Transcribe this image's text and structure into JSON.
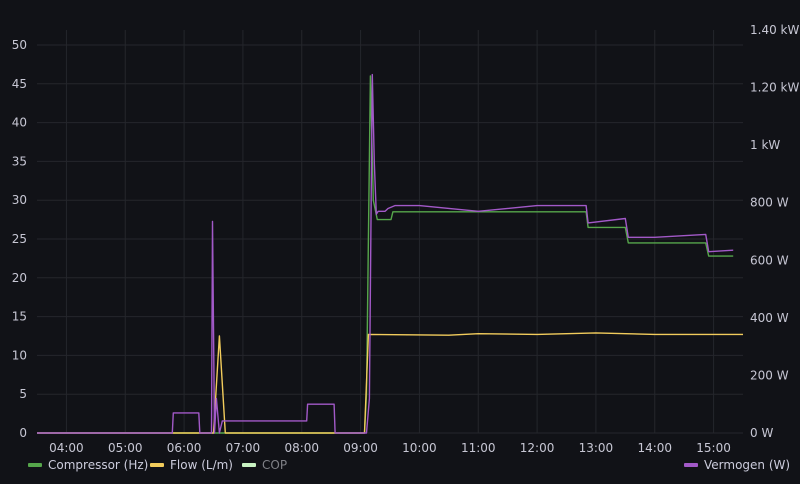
{
  "chart_data": {
    "type": "line",
    "x_label_type": "time",
    "x_ticks": [
      "04:00",
      "05:00",
      "06:00",
      "07:00",
      "08:00",
      "09:00",
      "10:00",
      "11:00",
      "12:00",
      "13:00",
      "14:00",
      "15:00"
    ],
    "x_range": [
      "03:30",
      "15:30"
    ],
    "y_left": {
      "ticks": [
        "0",
        "5",
        "10",
        "15",
        "20",
        "25",
        "30",
        "35",
        "40",
        "45",
        "50"
      ],
      "range": [
        0,
        50
      ]
    },
    "y_right": {
      "ticks": [
        "0 W",
        "200 W",
        "400 W",
        "600 W",
        "800 W",
        "1 kW",
        "1.20 kW",
        "1.40 kW"
      ],
      "range_watts": [
        0,
        1400
      ]
    },
    "grid": true,
    "legend_position": "bottom",
    "series": [
      {
        "name": "Compressor (Hz)",
        "axis": "left",
        "color": "#56a64b",
        "points": [
          [
            "03:30",
            0
          ],
          [
            "09:04",
            0
          ],
          [
            "09:06",
            5
          ],
          [
            "09:10",
            46
          ],
          [
            "09:13",
            30
          ],
          [
            "09:17",
            27.5
          ],
          [
            "09:31",
            27.5
          ],
          [
            "09:33",
            28.5
          ],
          [
            "12:50",
            28.5
          ],
          [
            "12:52",
            26.5
          ],
          [
            "13:30",
            26.5
          ],
          [
            "13:33",
            24.5
          ],
          [
            "14:52",
            24.5
          ],
          [
            "14:55",
            22.8
          ],
          [
            "15:20",
            22.8
          ]
        ]
      },
      {
        "name": "Flow (L/m)",
        "axis": "left",
        "color": "#f2cc5c",
        "points": [
          [
            "03:30",
            0
          ],
          [
            "06:30",
            0
          ],
          [
            "06:36",
            12.5
          ],
          [
            "06:42",
            0
          ],
          [
            "09:04",
            0
          ],
          [
            "09:08",
            12.7
          ],
          [
            "10:30",
            12.6
          ],
          [
            "11:00",
            12.8
          ],
          [
            "12:00",
            12.7
          ],
          [
            "13:00",
            12.9
          ],
          [
            "14:00",
            12.7
          ],
          [
            "15:30",
            12.7
          ]
        ]
      },
      {
        "name": "COP",
        "axis": "left",
        "color": "#c8f2c2",
        "muted": true,
        "points": []
      },
      {
        "name": "Vermogen (W)",
        "axis": "right",
        "color": "#a259c8",
        "points": [
          [
            "03:30",
            0
          ],
          [
            "05:48",
            0
          ],
          [
            "05:49",
            70
          ],
          [
            "06:15",
            70
          ],
          [
            "06:16",
            0
          ],
          [
            "06:28",
            0
          ],
          [
            "06:29",
            735
          ],
          [
            "06:31",
            0
          ],
          [
            "06:33",
            120
          ],
          [
            "06:36",
            0
          ],
          [
            "06:39",
            42
          ],
          [
            "08:05",
            42
          ],
          [
            "08:06",
            100
          ],
          [
            "08:33",
            100
          ],
          [
            "08:34",
            0
          ],
          [
            "09:06",
            0
          ],
          [
            "09:09",
            120
          ],
          [
            "09:12",
            1245
          ],
          [
            "09:14",
            940
          ],
          [
            "09:16",
            760
          ],
          [
            "09:18",
            770
          ],
          [
            "09:25",
            770
          ],
          [
            "09:28",
            780
          ],
          [
            "09:35",
            790
          ],
          [
            "10:00",
            790
          ],
          [
            "11:00",
            770
          ],
          [
            "12:00",
            790
          ],
          [
            "12:50",
            790
          ],
          [
            "12:52",
            730
          ],
          [
            "13:30",
            745
          ],
          [
            "13:33",
            680
          ],
          [
            "14:00",
            680
          ],
          [
            "14:52",
            690
          ],
          [
            "14:55",
            630
          ],
          [
            "15:20",
            635
          ]
        ]
      }
    ]
  }
}
